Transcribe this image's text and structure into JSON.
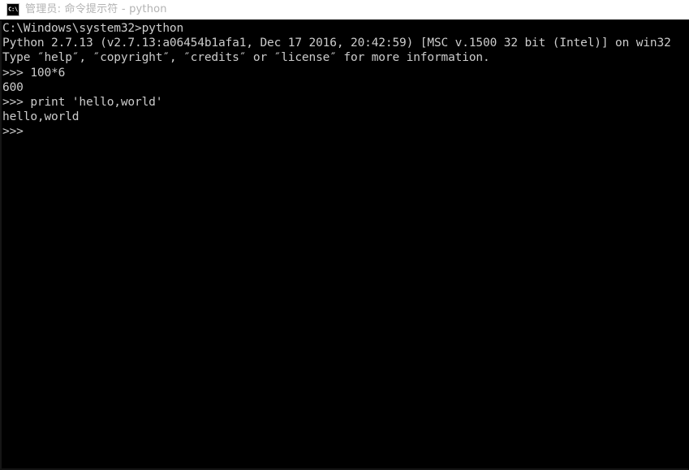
{
  "window": {
    "titlebar": {
      "icon_name": "cmd-console-icon",
      "icon_glyph": "C:\\",
      "title": "管理员: 命令提示符 - python"
    },
    "colors": {
      "titlebar_background": "#ffffff",
      "title_text": "#b3b3b3",
      "console_background": "#000000",
      "console_text": "#cccccc"
    }
  },
  "console": {
    "lines": [
      "C:\\Windows\\system32>python",
      "Python 2.7.13 (v2.7.13:a06454b1afa1, Dec 17 2016, 20:42:59) [MSC v.1500 32 bit (Intel)] on win32",
      "Type ″help″, ″copyright″, ″credits″ or ″license″ for more information.",
      ">>> 100*6",
      "600",
      ">>> print 'hello,world'",
      "hello,world",
      ">>>"
    ]
  }
}
